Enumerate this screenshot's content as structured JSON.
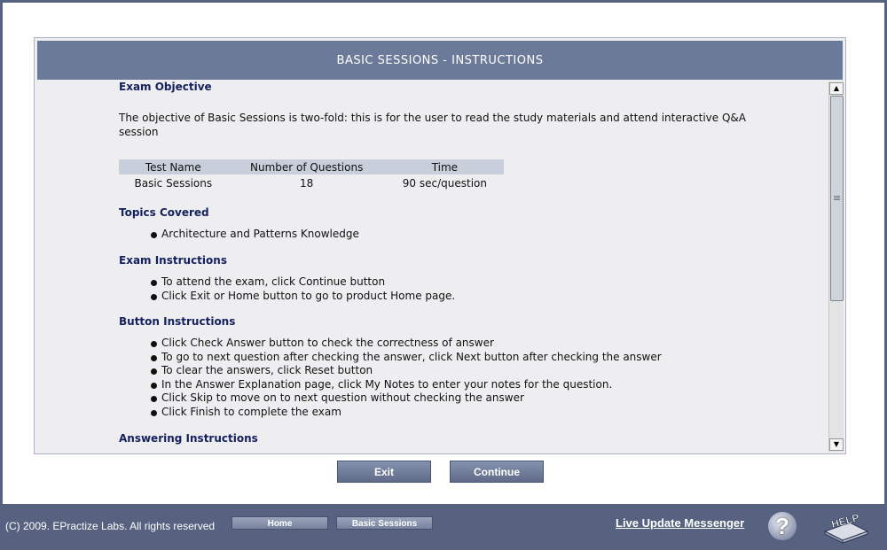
{
  "panel": {
    "title": "BASIC SESSIONS - INSTRUCTIONS"
  },
  "exam_objective": {
    "heading": "Exam Objective",
    "text": "The objective of Basic Sessions is two-fold: this is for the user to read the study materials and attend interactive Q&A session"
  },
  "table": {
    "headers": [
      "Test Name",
      "Number of Questions",
      "Time"
    ],
    "row": [
      "Basic Sessions",
      "18",
      "90 sec/question"
    ]
  },
  "topics": {
    "heading": "Topics Covered",
    "items": [
      "Architecture and Patterns Knowledge"
    ]
  },
  "exam_instructions": {
    "heading": "Exam Instructions",
    "items": [
      "To attend the exam, click Continue button",
      "Click Exit or Home button to go to product Home page."
    ]
  },
  "button_instructions": {
    "heading": "Button Instructions",
    "items": [
      "Click Check Answer button to check the correctness of answer",
      "To go to next question after checking the answer, click Next button after checking the answer",
      "To clear the answers, click Reset button",
      "In the Answer Explanation page, click My Notes to enter your notes for the question.",
      "Click Skip to move on to next question without checking the answer",
      "Click Finish to complete the exam"
    ]
  },
  "answering_instructions": {
    "heading": "Answering Instructions"
  },
  "buttons": {
    "exit": "Exit",
    "continue": "Continue"
  },
  "footer": {
    "copyright": "(C) 2009. EPractize Labs. All rights reserved",
    "home": "Home",
    "basic_sessions": "Basic Sessions",
    "live_update": "Live Update Messenger",
    "help_icon_text": "HELP"
  },
  "icons": {
    "question": "question-mark-icon",
    "help": "help-book-icon",
    "scroll_up": "arrow-up-icon",
    "scroll_down": "arrow-down-icon"
  }
}
